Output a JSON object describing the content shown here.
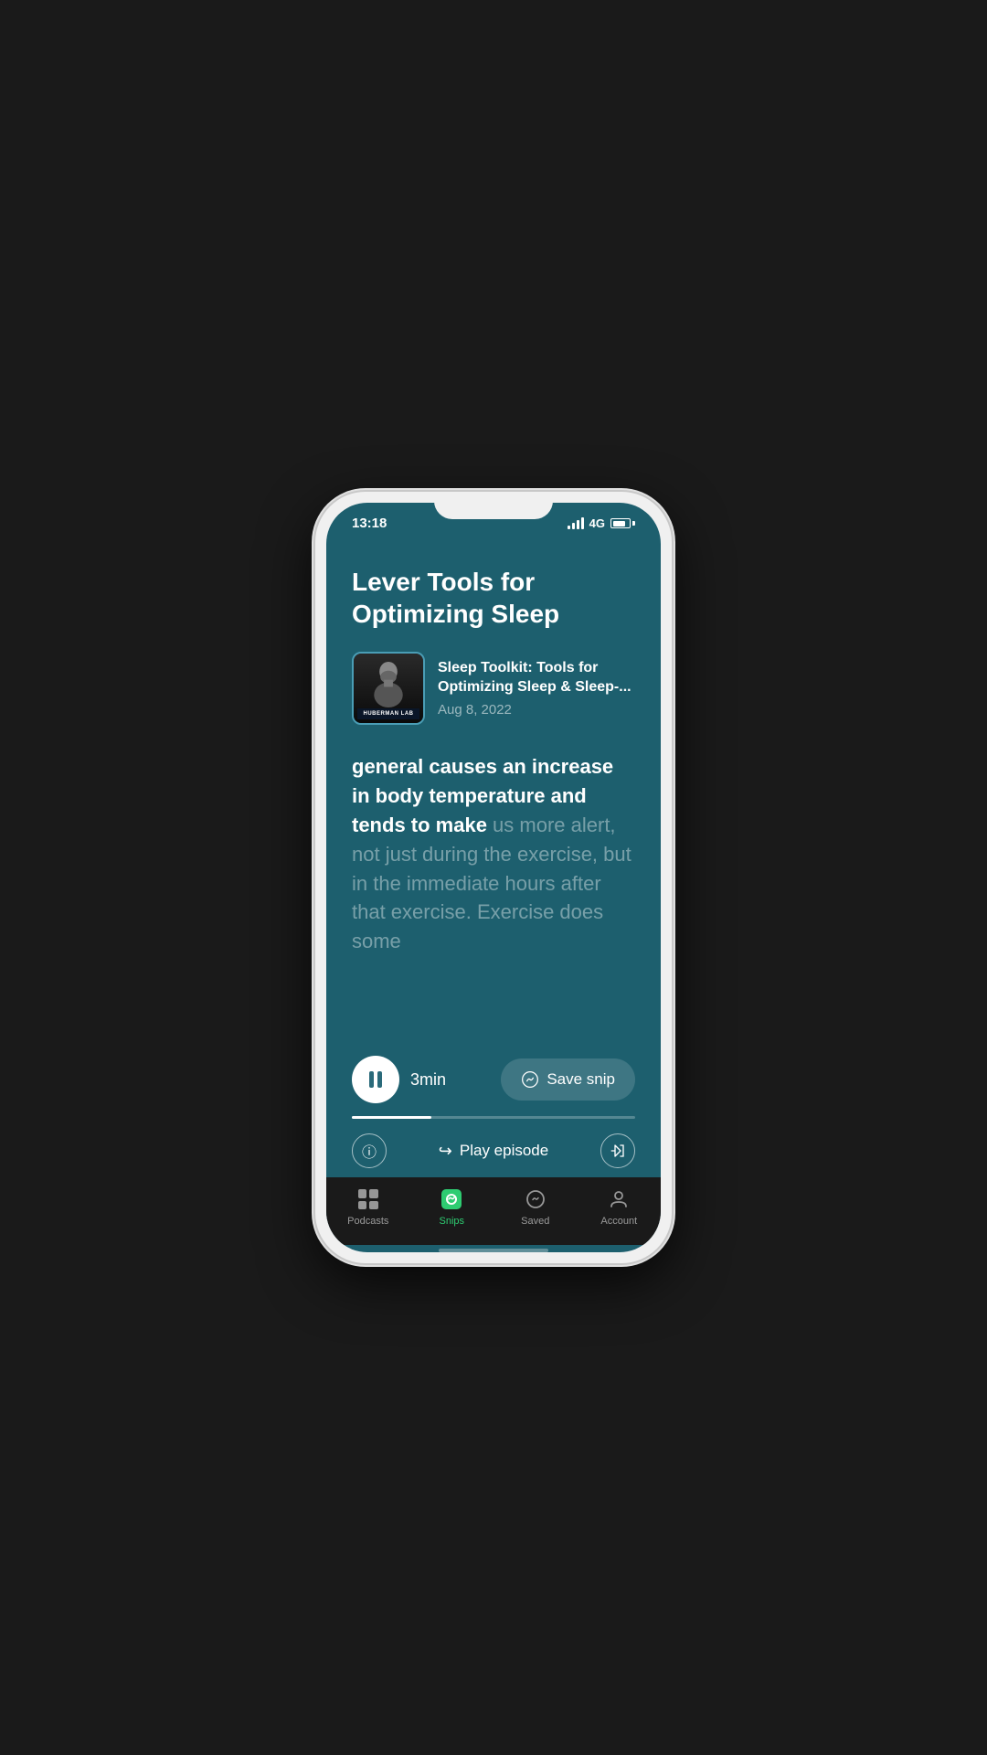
{
  "status_bar": {
    "time": "13:18",
    "network": "4G"
  },
  "episode": {
    "title": "Lever Tools for Optimizing Sleep",
    "podcast_name": "Sleep Toolkit: Tools for Optimizing Sleep & Sleep-...",
    "podcast_date": "Aug 8, 2022",
    "podcast_label": "HUBERMAN LAB"
  },
  "transcript": {
    "highlighted": "general causes an increase in body temperature and tends to make",
    "dimmed": " us more alert, not just during the exercise, but in the immediate hours after that exercise. Exercise does some"
  },
  "player": {
    "duration": "3min",
    "progress_percent": 28,
    "save_snip_label": "Save snip",
    "play_episode_label": "Play episode"
  },
  "tab_bar": {
    "tabs": [
      {
        "id": "podcasts",
        "label": "Podcasts",
        "active": false
      },
      {
        "id": "snips",
        "label": "Snips",
        "active": true
      },
      {
        "id": "saved",
        "label": "Saved",
        "active": false
      },
      {
        "id": "account",
        "label": "Account",
        "active": false
      }
    ]
  },
  "colors": {
    "background": "#1d5f6e",
    "active_tab": "#2ecc71",
    "tab_bar_bg": "#1a1a1a"
  }
}
